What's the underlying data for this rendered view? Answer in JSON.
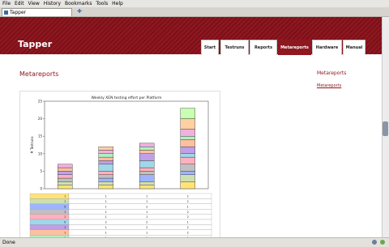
{
  "menu": [
    "File",
    "Edit",
    "View",
    "History",
    "Bookmarks",
    "Tools",
    "Help"
  ],
  "browser_tab": {
    "title": "Tapper",
    "new_tab": "✚"
  },
  "site": {
    "logo": "Tapper",
    "nav": [
      {
        "label": "Start"
      },
      {
        "label": "Testruns"
      },
      {
        "label": "Reports"
      },
      {
        "label": "Metareports",
        "active": true
      },
      {
        "label": "Hardware"
      },
      {
        "label": "Manual"
      }
    ],
    "content_title": "Metareports",
    "sidebar_title": "Metareports",
    "sidebar_link": "Metareports"
  },
  "status": {
    "text": "Done"
  },
  "chart_data": {
    "type": "bar",
    "title": "Weekly XEN testing effort per Platform",
    "ylabel": "# Testruns",
    "ylim": [
      0,
      25
    ],
    "yticks": [
      0,
      5,
      10,
      15,
      20,
      25
    ],
    "categories": [
      "",
      "",
      "",
      ""
    ],
    "stack_colors": [
      "#ffe37a",
      "#cfe0b0",
      "#9fb4ff",
      "#c0c0c0",
      "#ffb0c0",
      "#9fd8e8",
      "#c0a0e8",
      "#ffc0a0",
      "#b0f0c0",
      "#f0b0e0",
      "#ffd0a0",
      "#c8ffb0"
    ],
    "series_totals": [
      7,
      12,
      13,
      23
    ],
    "segments": [
      [
        1,
        1,
        0,
        1,
        1,
        0,
        1,
        1,
        0,
        1
      ],
      [
        1,
        1,
        1,
        1,
        1,
        2,
        1,
        1,
        1,
        1,
        1
      ],
      [
        1,
        1,
        2,
        1,
        1,
        2,
        2,
        1,
        1,
        1
      ],
      [
        2,
        2,
        1,
        2,
        2,
        1,
        2,
        2,
        1,
        2,
        3,
        3
      ]
    ]
  }
}
